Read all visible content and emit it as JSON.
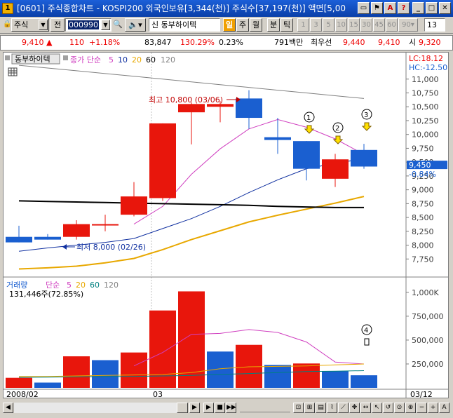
{
  "window": {
    "title": "[0601] 주식종합차트 - KOSPI200 외국인보유[3,344(천)] 주식수[37,197(천)] 액면[5,00"
  },
  "toolbar": {
    "market_label": "주식",
    "jeon_label": "전",
    "code_value": "000990",
    "stock_name": "신 동부하이텍",
    "tabs": [
      "일",
      "주",
      "월",
      "분",
      "틱"
    ],
    "periods": [
      "1",
      "3",
      "5",
      "10",
      "15",
      "30",
      "45",
      "60"
    ],
    "periods_extra": "90",
    "count_value": "13"
  },
  "quote": {
    "price": "9,410",
    "change": "110",
    "change_pct": "+1.18%",
    "volume": "83,847",
    "vol_ratio": "130.29%",
    "turnover": "0.23%",
    "amount": "791백만",
    "best_ask_label": "최우선",
    "best_ask": "9,440",
    "best_bid": "9,410",
    "open_label": "시",
    "open": "9,320"
  },
  "price_panel": {
    "stock_tab": "동부하이텍",
    "indicator_label": "종가 단순",
    "ma_periods": [
      "5",
      "10",
      "20",
      "60",
      "120"
    ],
    "lc": "LC:18.12",
    "hc": "HC:-12.50",
    "current_price": "9,450",
    "current_pct": "-0.84%",
    "high_annotation": "최고 10,800 (03/06)",
    "low_annotation": "최저 8,000 (02/26)",
    "markers": [
      "①",
      "②",
      "③"
    ],
    "axis_ticks": [
      "11,000",
      "10,750",
      "10,500",
      "10,250",
      "10,000",
      "9,750",
      "9,500",
      "9,250",
      "9,000",
      "8,750",
      "8,500",
      "8,250",
      "8,000",
      "7,750"
    ]
  },
  "volume_panel": {
    "label": "거래량",
    "indicator_label": "단순",
    "ma_periods": [
      "5",
      "20",
      "60",
      "120"
    ],
    "current_volume": "131,446주(72.85%)",
    "marker": "④",
    "axis_ticks": [
      "1,000K",
      "750,000",
      "500,000",
      "250,000"
    ]
  },
  "xaxis": {
    "start": "2008/02",
    "mid": "03",
    "end": "03/12"
  },
  "colors": {
    "up": "#e8160c",
    "down": "#1a5fd0",
    "ma5": "#d040c0",
    "ma10": "#1030a0",
    "ma20": "#e8a800",
    "ma60": "#000000",
    "ma120": "#808080"
  },
  "chart_data": [
    {
      "type": "candlestick",
      "title": "동부하이텍",
      "ylim": [
        7500,
        11200
      ],
      "candles": [
        {
          "o": 8150,
          "h": 8350,
          "l": 8050,
          "c": 8050
        },
        {
          "o": 8150,
          "h": 8200,
          "l": 8100,
          "c": 8100
        },
        {
          "o": 8150,
          "h": 8450,
          "l": 8100,
          "c": 8380
        },
        {
          "o": 8380,
          "h": 8550,
          "l": 8250,
          "c": 8380
        },
        {
          "o": 8550,
          "h": 9140,
          "l": 8520,
          "c": 8880
        },
        {
          "o": 8850,
          "h": 10200,
          "l": 8800,
          "c": 10200
        },
        {
          "o": 10400,
          "h": 10580,
          "l": 9820,
          "c": 10550
        },
        {
          "o": 10500,
          "h": 10600,
          "l": 10220,
          "c": 10550
        },
        {
          "o": 10650,
          "h": 10800,
          "l": 10100,
          "c": 10300
        },
        {
          "o": 9950,
          "h": 10300,
          "l": 9650,
          "c": 9900
        },
        {
          "o": 9880,
          "h": 9880,
          "l": 9170,
          "c": 9380
        },
        {
          "o": 9200,
          "h": 9650,
          "l": 9050,
          "c": 9550
        },
        {
          "o": 9720,
          "h": 9830,
          "l": 9380,
          "c": 9420
        }
      ],
      "series": [
        {
          "name": "5",
          "values": [
            null,
            null,
            null,
            null,
            8380,
            8700,
            9280,
            9740,
            10100,
            10270,
            10130,
            9920,
            9640
          ]
        },
        {
          "name": "10",
          "values": [
            7890,
            7950,
            8000,
            8050,
            8120,
            8300,
            8480,
            8700,
            8950,
            9180,
            9380,
            9480,
            9560
          ]
        },
        {
          "name": "20",
          "values": [
            7570,
            7590,
            7620,
            7680,
            7760,
            7920,
            8100,
            8260,
            8420,
            8540,
            8650,
            8760,
            8880
          ]
        },
        {
          "name": "60",
          "values": [
            8800,
            8790,
            8780,
            8770,
            8760,
            8750,
            8740,
            8730,
            8720,
            8700,
            8690,
            8680,
            8680
          ]
        },
        {
          "name": "120",
          "values": [
            11250,
            11200,
            11150,
            11100,
            11050,
            11000,
            10950,
            10900,
            10850,
            10800,
            10750,
            10700,
            10650
          ]
        }
      ]
    },
    {
      "type": "bar",
      "title": "거래량",
      "ylim": [
        0,
        1050000
      ],
      "values": [
        105000,
        55000,
        330000,
        290000,
        370000,
        810000,
        1010000,
        380000,
        450000,
        240000,
        255000,
        175000,
        131446
      ],
      "up": [
        true,
        false,
        true,
        false,
        true,
        true,
        true,
        false,
        true,
        false,
        true,
        false,
        false
      ],
      "series": [
        {
          "name": "5",
          "values": [
            null,
            null,
            null,
            null,
            230000,
            370000,
            560000,
            570000,
            610000,
            580000,
            480000,
            270000,
            250000
          ]
        },
        {
          "name": "20",
          "values": [
            120000,
            120000,
            125000,
            130000,
            135000,
            140000,
            160000,
            200000,
            220000,
            225000,
            230000,
            240000,
            250000
          ]
        },
        {
          "name": "60",
          "values": [
            110000,
            112000,
            115000,
            118000,
            120000,
            125000,
            130000,
            140000,
            150000,
            160000,
            170000,
            175000,
            180000
          ]
        }
      ]
    }
  ]
}
